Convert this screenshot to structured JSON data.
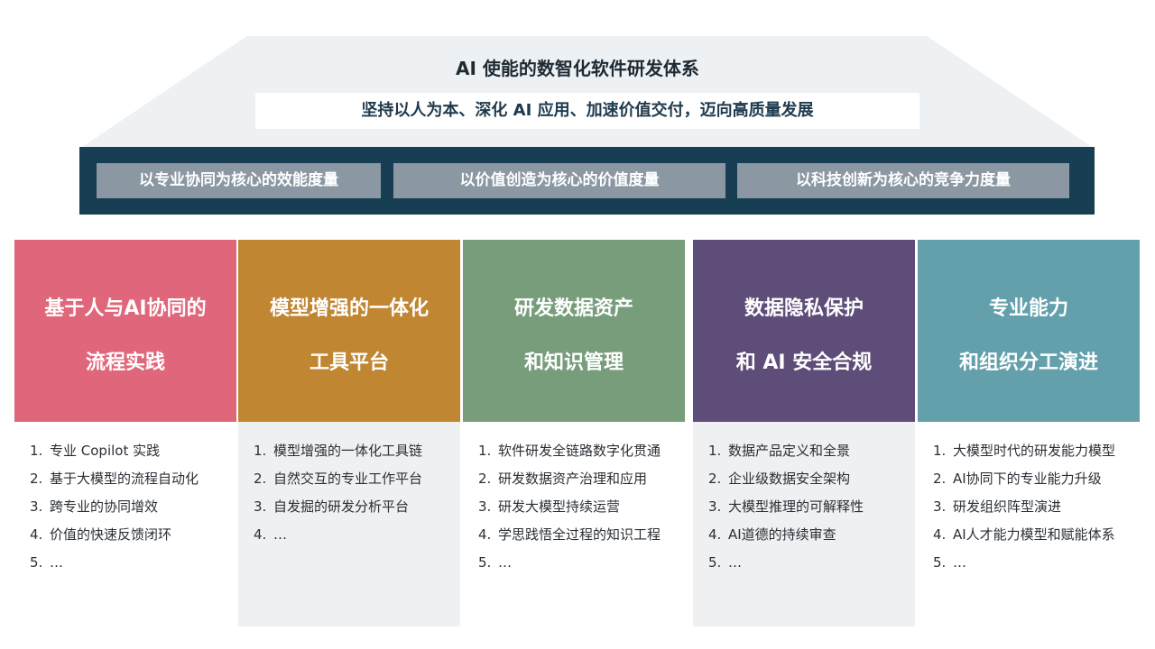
{
  "header": {
    "title": "AI 使能的数智化软件研发体系",
    "subtitle": "坚持以人为本、深化 AI 应用、加速价值交付，迈向高质量发展"
  },
  "metrics": [
    "以专业协同为核心的效能度量",
    "以价值创造为核心的价值度量",
    "以科技创新为核心的竞争力度量"
  ],
  "colors": {
    "pillar1": "#e0677b",
    "pillar2": "#c08632",
    "pillar3": "#779d7b",
    "pillar4": "#5e4d78",
    "pillar5": "#63a0ac",
    "band": "#173e52",
    "metric_box": "#8b98a3"
  },
  "pillars": [
    {
      "line1": "基于人与AI协同的",
      "line2": "流程实践",
      "items": [
        "专业 Copilot 实践",
        "基于大模型的流程自动化",
        "跨专业的协同增效",
        "价值的快速反馈闭环",
        "…"
      ]
    },
    {
      "line1": "模型增强的一体化",
      "line2": "工具平台",
      "items": [
        "模型增强的一体化工具链",
        "自然交互的专业工作平台",
        "自发掘的研发分析平台",
        "…"
      ]
    },
    {
      "line1": "研发数据资产",
      "line2": "和知识管理",
      "items": [
        "软件研发全链路数字化贯通",
        "研发数据资产治理和应用",
        "研发大模型持续运营",
        "学思践悟全过程的知识工程",
        "…"
      ]
    },
    {
      "line1": "数据隐私保护",
      "line2": "和 AI 安全合规",
      "items": [
        "数据产品定义和全景",
        "企业级数据安全架构",
        "大模型推理的可解释性",
        "AI道德的持续审查",
        "…"
      ]
    },
    {
      "line1": "专业能力",
      "line2": "和组织分工演进",
      "items": [
        "大模型时代的研发能力模型",
        "AI协同下的专业能力升级",
        "研发组织阵型演进",
        "AI人才能力模型和赋能体系",
        "…"
      ]
    }
  ]
}
